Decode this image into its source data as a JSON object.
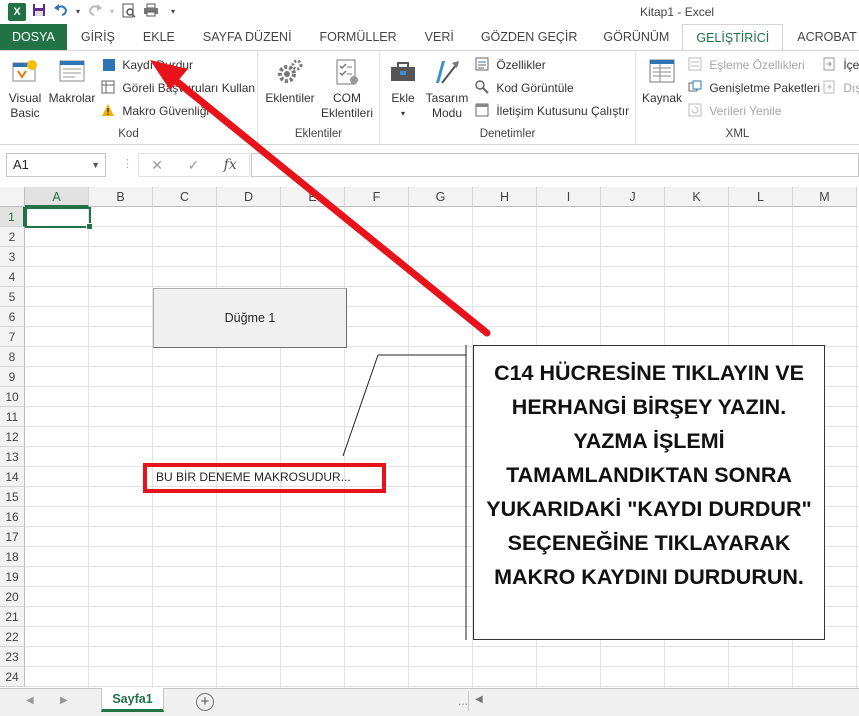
{
  "window": {
    "title": "Kitap1 - Excel"
  },
  "qat": {
    "icons": [
      "excel-icon",
      "save-icon",
      "undo-icon",
      "redo-icon",
      "print-preview-icon",
      "quick-print-icon",
      "customize-icon"
    ]
  },
  "tabs": [
    "DOSYA",
    "GİRİŞ",
    "EKLE",
    "SAYFA DÜZENİ",
    "FORMÜLLER",
    "VERİ",
    "GÖZDEN GEÇİR",
    "GÖRÜNÜM",
    "GELİŞTİRİCİ",
    "ACROBAT"
  ],
  "active_tab": "GELİŞTİRİCİ",
  "ribbon": {
    "kod": {
      "label": "Kod",
      "visual_basic": "Visual\nBasic",
      "makrolar": "Makrolar",
      "kaydi_durdur": "Kaydı Durdur",
      "goreli": "Göreli Başvuruları Kullan",
      "guvenlik": "Makro Güvenliği"
    },
    "eklentiler": {
      "label": "Eklentiler",
      "eklentiler_btn": "Eklentiler",
      "com": "COM\nEklentileri"
    },
    "denetimler": {
      "label": "Denetimler",
      "ekle": "Ekle",
      "tasarim": "Tasarım\nModu",
      "ozellikler": "Özellikler",
      "kod_goruntule": "Kod Görüntüle",
      "iletisim": "İletişim Kutusunu Çalıştır"
    },
    "xml": {
      "label": "XML",
      "kaynak": "Kaynak",
      "esleme": "Eşleme Özellikleri",
      "genisletme": "Genişletme Paketleri",
      "verileri_yenile": "Verileri Yenile",
      "ice": "İçe",
      "disa": "Dışa"
    }
  },
  "formula_bar": {
    "name_box": "A1",
    "cancel": "✕",
    "enter": "✓",
    "fx": "fx",
    "value": ""
  },
  "columns": [
    "A",
    "B",
    "C",
    "D",
    "E",
    "F",
    "G",
    "H",
    "I",
    "J",
    "K",
    "L",
    "M"
  ],
  "rows": [
    "1",
    "2",
    "3",
    "4",
    "5",
    "6",
    "7",
    "8",
    "9",
    "10",
    "11",
    "12",
    "13",
    "14",
    "15",
    "16",
    "17",
    "18",
    "19",
    "20",
    "21",
    "22",
    "23",
    "24"
  ],
  "selected_cell": "A1",
  "form_button": {
    "label": "Düğme 1"
  },
  "cell_c14": {
    "value": "BU BİR DENEME MAKROSUDUR..."
  },
  "callout": {
    "text": "C14 HÜCRESİNE TIKLAYIN VE HERHANGİ BİRŞEY YAZIN. YAZMA İŞLEMİ TAMAMLANDIKTAN SONRA YUKARIDAKİ \"KAYDI DURDUR\" SEÇENEĞİNE TIKLAYARAK MAKRO KAYDINI DURDURUN."
  },
  "sheets": {
    "tabs": [
      "Sayfa1"
    ],
    "ellipsis": "..."
  },
  "colors": {
    "excel_green": "#217346",
    "annotation_red": "#e8121b"
  }
}
